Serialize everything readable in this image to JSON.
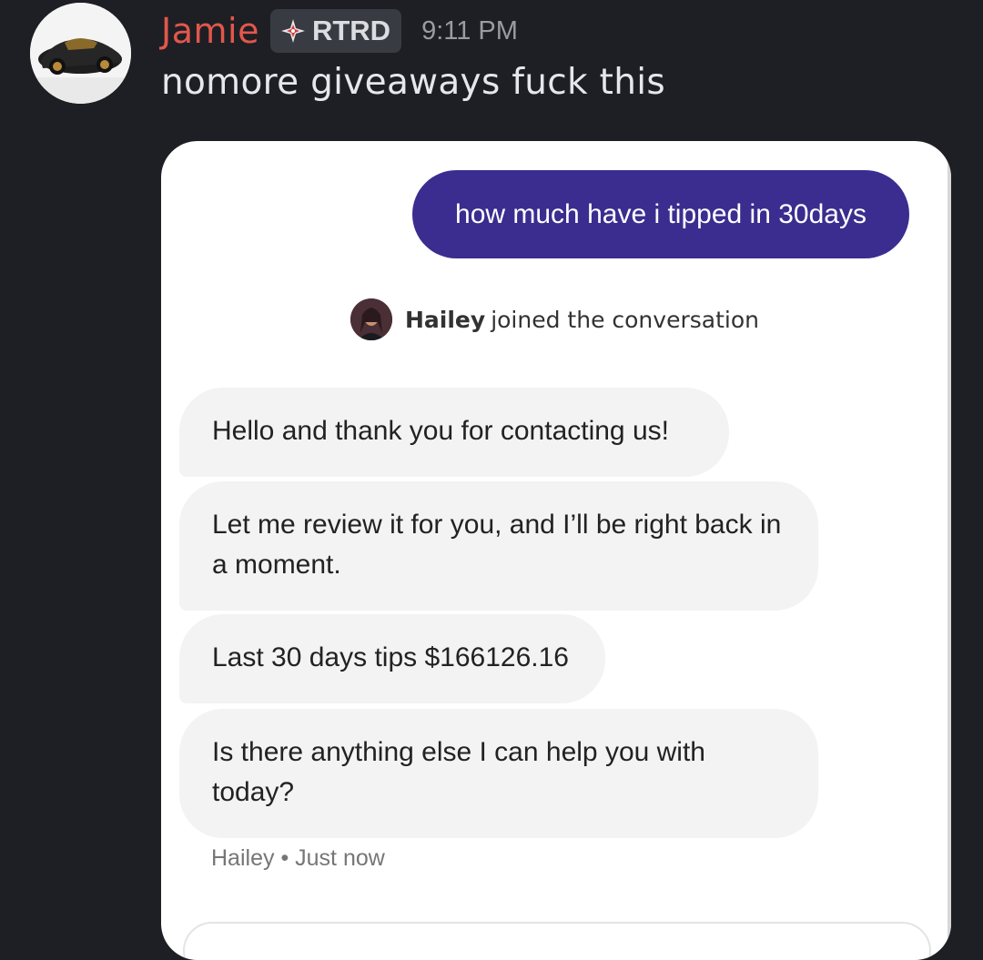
{
  "message": {
    "username": "Jamie",
    "role_badge": "RTRD",
    "timestamp": "9:11 PM",
    "text": "nomore giveaways fuck this"
  },
  "chat_screenshot": {
    "user_message": "how much have i tipped in 30days",
    "join_notice": {
      "agent_name": "Hailey",
      "text": "joined the conversation"
    },
    "agent_messages": [
      "Hello and thank you for contacting us!",
      "Let me review it for you, and I’ll be right back in a moment.",
      "Last 30 days tips $166126.16",
      "Is there anything else I can help you with today?"
    ],
    "footer": {
      "sender": "Hailey",
      "separator": "•",
      "time": "Just now"
    }
  },
  "colors": {
    "background": "#1e1f24",
    "username": "#e3574b",
    "user_bubble": "#3a2d8f",
    "agent_bubble": "#f3f3f3"
  },
  "icons": {
    "role_badge_icon": "diamond-compass-icon",
    "avatar": "sports-car-avatar",
    "agent_avatar": "agent-portrait-avatar"
  }
}
